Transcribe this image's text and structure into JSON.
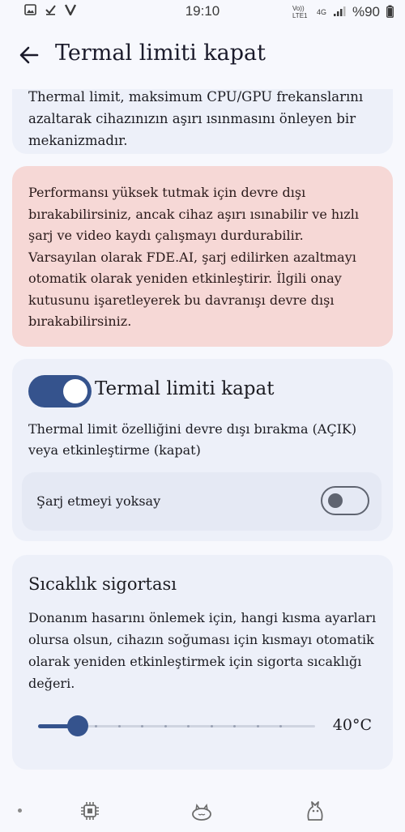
{
  "status_bar": {
    "time": "19:10",
    "network_label": "Vo)) LTE1",
    "network_type": "4G",
    "battery": "%90",
    "left_icons": [
      "image-icon",
      "check-icon",
      "v-icon"
    ]
  },
  "app_bar": {
    "title": "Termal limiti kapat",
    "back_icon": "arrow-left-icon"
  },
  "info_card": {
    "text": "Thermal limit, maksimum CPU/GPU frekanslarını azaltarak cihazınızın aşırı ısınmasını önleyen bir mekanizmadır."
  },
  "warning_card": {
    "text": "Performansı yüksek tutmak için devre dışı bırakabilirsiniz, ancak cihaz aşırı ısınabilir ve hızlı şarj ve video kaydı çalışmayı durdurabilir. Varsayılan olarak FDE.AI, şarj edilirken azaltmayı otomatik olarak yeniden etkinleştirir. İlgili onay kutusunu işaretleyerek bu davranışı devre dışı bırakabilirsiniz.",
    "background": "#f6d8d6"
  },
  "thermal_card": {
    "toggle_label": "Termal limiti kapat",
    "toggle_on": true,
    "description": "Thermal limit özelliğini devre dışı bırakma (AÇIK) veya etkinleştirme (kapat)",
    "sub_option": {
      "label": "Şarj etmeyi yoksay",
      "on": false
    }
  },
  "fuse_card": {
    "title": "Sıcaklık sigortası",
    "description": "Donanım hasarını önlemek için, hangi kısma ayarları olursa olsun, cihazın soğuması için kısmayı otomatik olarak yeniden etkinleştirmek için sigorta sıcaklığı değeri.",
    "slider": {
      "value_label": "40°C",
      "position_fraction": 0.11,
      "steps": 11
    }
  },
  "bottom_nav": {
    "items": [
      "dot-indicator",
      "cpu-chip-icon",
      "sleeping-cat-icon",
      "cat-icon"
    ]
  },
  "colors": {
    "accent": "#35538d",
    "card": "#edf0f9",
    "background": "#f7f8fd"
  }
}
